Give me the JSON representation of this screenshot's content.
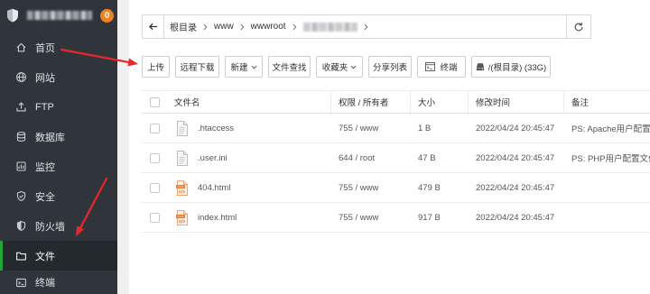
{
  "sidebar": {
    "badge": "0",
    "items": [
      {
        "label": "首页",
        "icon": "home-icon"
      },
      {
        "label": "网站",
        "icon": "globe-icon"
      },
      {
        "label": "FTP",
        "icon": "ftp-icon"
      },
      {
        "label": "数据库",
        "icon": "database-icon"
      },
      {
        "label": "监控",
        "icon": "monitor-icon"
      },
      {
        "label": "安全",
        "icon": "security-icon"
      },
      {
        "label": "防火墙",
        "icon": "firewall-icon"
      },
      {
        "label": "文件",
        "icon": "folder-icon",
        "active": true
      },
      {
        "label": "终端",
        "icon": "terminal-icon"
      }
    ]
  },
  "breadcrumb": {
    "back_icon": "arrow-left-icon",
    "segments": [
      "根目录",
      "www",
      "wwwroot"
    ],
    "refresh_icon": "refresh-icon"
  },
  "toolbar": {
    "upload": "上传",
    "remote_download": "远程下载",
    "new": "新建",
    "find": "文件查找",
    "favorites": "收藏夹",
    "share_list": "分享列表",
    "terminal": "终端",
    "disk": "/(根目录) (33G)"
  },
  "table": {
    "columns": [
      "文件名",
      "权限 / 所有者",
      "大小",
      "修改时间",
      "备注"
    ],
    "rows": [
      {
        "icon": "text-file-icon",
        "name": ".htaccess",
        "perm": "755 / www",
        "size": "1 B",
        "mtime": "2022/04/24 20:45:47",
        "remark": "PS: Apache用户配置文"
      },
      {
        "icon": "text-file-icon",
        "name": ".user.ini",
        "perm": "644 / root",
        "size": "47 B",
        "mtime": "2022/04/24 20:45:47",
        "remark": "PS: PHP用户配置文件"
      },
      {
        "icon": "html-file-icon",
        "name": "404.html",
        "perm": "755 / www",
        "size": "479 B",
        "mtime": "2022/04/24 20:45:47"
      },
      {
        "icon": "html-file-icon",
        "name": "index.html",
        "perm": "755 / www",
        "size": "917 B",
        "mtime": "2022/04/24 20:45:47"
      }
    ]
  },
  "colors": {
    "sidebar_bg": "#30353b",
    "accent": "#20a53a",
    "badge": "#f0821e",
    "annotation_arrow": "#e8262b"
  }
}
